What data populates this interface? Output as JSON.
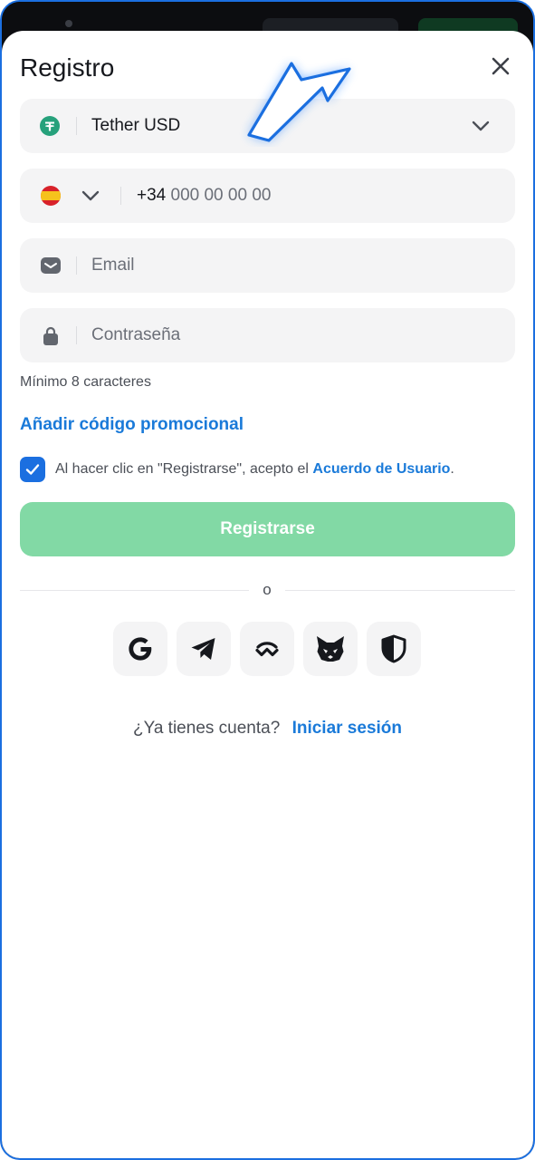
{
  "dialog": {
    "title": "Registro",
    "close_icon": "close-icon"
  },
  "currency": {
    "icon": "tether-icon",
    "label": "Tether USD",
    "accent": "#26a17b"
  },
  "phone": {
    "flag_icon": "spain-flag-icon",
    "code": "+34",
    "placeholder": "000 00 00 00"
  },
  "email": {
    "icon": "mail-icon",
    "placeholder": "Email"
  },
  "password": {
    "icon": "lock-icon",
    "placeholder": "Contraseña",
    "hint": "Mínimo 8 caracteres"
  },
  "promo_link": "Añadir código promocional",
  "agreement": {
    "checked": true,
    "text": "Al hacer clic en \"Registrarse\", acepto el",
    "link": "Acuerdo de Usuario",
    "suffix": "."
  },
  "submit_label": "Registrarse",
  "divider_text": "o",
  "social": [
    {
      "icon": "google-icon"
    },
    {
      "icon": "telegram-icon"
    },
    {
      "icon": "walletconnect-icon"
    },
    {
      "icon": "metamask-icon"
    },
    {
      "icon": "shield-icon"
    }
  ],
  "footer": {
    "question": "¿Ya tienes cuenta?",
    "login_link": "Iniciar sesión"
  },
  "colors": {
    "accent_blue": "#1a7ad9",
    "submit_green": "#82d9a5",
    "frame_border": "#1b6fe0"
  }
}
